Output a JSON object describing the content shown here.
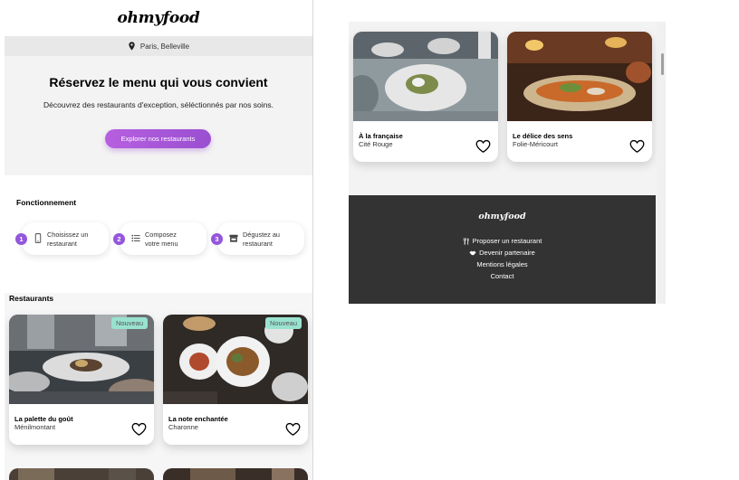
{
  "header": {
    "logo": "ohmyfood"
  },
  "location": {
    "icon": "pin-icon",
    "text": "Paris, Belleville"
  },
  "hero": {
    "title": "Réservez le menu qui vous convient",
    "subtitle": "Découvrez des restaurants d'exception, séléctionnés par nos soins.",
    "button_label": "Explorer nos restaurants"
  },
  "how": {
    "title": "Fonctionnement",
    "steps": [
      {
        "number": "1",
        "icon": "phone-icon",
        "line1": "Choisissez un",
        "line2": "restaurant"
      },
      {
        "number": "2",
        "icon": "list-icon",
        "line1": "Composez",
        "line2": "votre menu"
      },
      {
        "number": "3",
        "icon": "store-icon",
        "line1": "Dégustez au",
        "line2": "restaurant"
      }
    ]
  },
  "restaurants": {
    "title": "Restaurants",
    "cards": [
      {
        "name": "La palette du goût",
        "area": "Ménilmontant",
        "badge": "Nouveau"
      },
      {
        "name": "La note enchantée",
        "area": "Charonne",
        "badge": "Nouveau"
      }
    ]
  },
  "right_cards": [
    {
      "name": "À la française",
      "area": "Cité Rouge"
    },
    {
      "name": "Le délice des sens",
      "area": "Folie-Méricourt"
    }
  ],
  "footer": {
    "logo": "ohmyfood",
    "links": [
      {
        "icon": "utensils-icon",
        "label": "Proposer un restaurant"
      },
      {
        "icon": "handshake-icon",
        "label": "Devenir partenaire"
      },
      {
        "icon": "",
        "label": "Mentions légales"
      },
      {
        "icon": "",
        "label": "Contact"
      }
    ]
  },
  "colors": {
    "accent": "#9356dc",
    "badge": "#99e2d0",
    "footer": "#333333"
  }
}
